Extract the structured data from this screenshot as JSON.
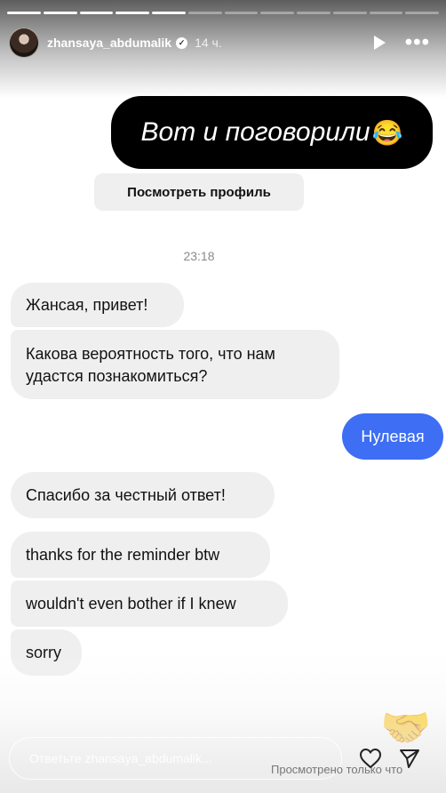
{
  "header": {
    "username": "zhansaya_abdumalik",
    "verified_mark": "✓",
    "time": "14 ч."
  },
  "story": {
    "progress": {
      "segments": 12,
      "completed": 5
    },
    "sticker_text": "Вот и поговорили",
    "sticker_emoji": "😂",
    "profile_button": "Посмотреть профиль",
    "timestamp": "23:18",
    "messages": {
      "m1": "Жансая, привет!",
      "m2": "Какова вероятность того, что нам удастся познакомиться?",
      "m3": "Нулевая",
      "m4": "Спасибо за честный ответ!",
      "m5": "thanks for the reminder btw",
      "m6": "wouldn't even bother if I knew",
      "m7": "sorry"
    },
    "handshake_emoji": "🤝"
  },
  "footer": {
    "reply_placeholder": "Ответьте zhansaya_abdumalik...",
    "seen_text": "Просмотрено только что"
  },
  "colors": {
    "outgoing_bubble": "#3d6ef3",
    "incoming_bubble": "#efefef",
    "sticker_bg": "#000000"
  },
  "icons": [
    "play-icon",
    "more-icon",
    "heart-icon",
    "send-icon",
    "verified-icon"
  ]
}
